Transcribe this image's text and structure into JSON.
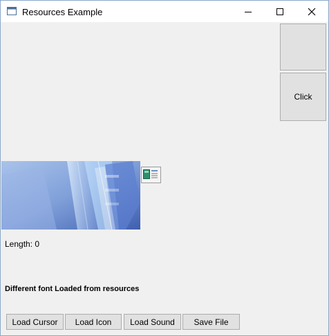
{
  "window": {
    "title": "Resources Example"
  },
  "top_button": {
    "label": ""
  },
  "click_button": {
    "label": "Click"
  },
  "length_label": "Length: 0",
  "font_label": "Different font Loaded from resources",
  "bottom_buttons": {
    "load_cursor": "Load Cursor",
    "load_icon": "Load Icon",
    "load_sound": "Load Sound",
    "save_file": "Save File"
  },
  "icons": {
    "app": "window-app-icon",
    "minimize": "minimize-icon",
    "maximize": "maximize-icon",
    "close": "close-icon",
    "resource": "document-resource-icon"
  },
  "colors": {
    "button_face": "#e1e1e1",
    "button_border": "#adadad",
    "client_bg": "#f0f0f0",
    "window_border": "#8aa7c8"
  }
}
